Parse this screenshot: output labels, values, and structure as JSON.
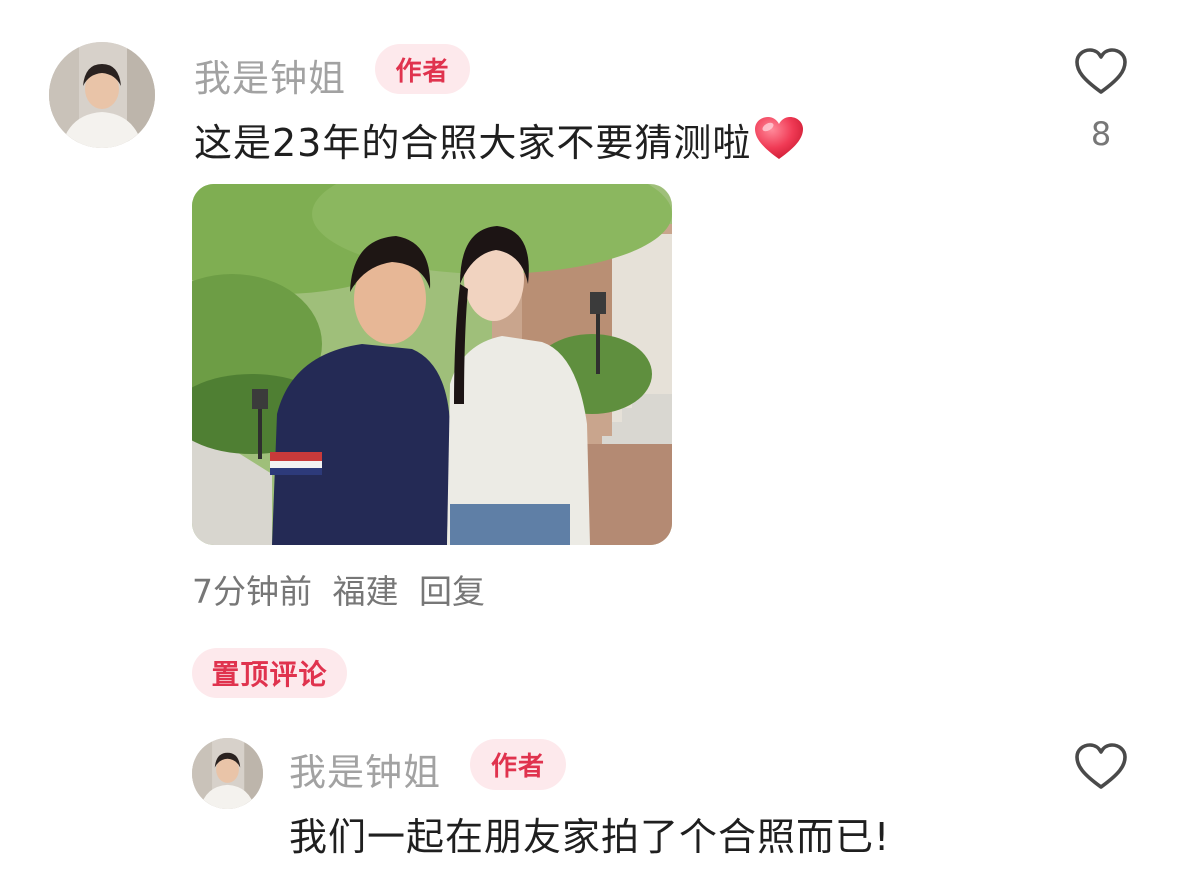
{
  "comment": {
    "author": "我是钟姐",
    "badge": "作者",
    "text": "这是23年的合照大家不要猜测啦",
    "emoji": "heart-emoji",
    "like_icon": "heart-outline-icon",
    "like_count": "8",
    "time": "7分钟前",
    "location": "福建",
    "reply_label": "回复"
  },
  "pinned_label": "置顶评论",
  "reply": {
    "author": "我是钟姐",
    "badge": "作者",
    "text": "我们一起在朋友家拍了个合照而已!",
    "like_icon": "heart-outline-icon"
  },
  "colors": {
    "accent": "#e0334e",
    "badge_bg": "#fde9ec",
    "name": "#a2a2a2",
    "text": "#1f1f1f",
    "meta": "#777777"
  }
}
